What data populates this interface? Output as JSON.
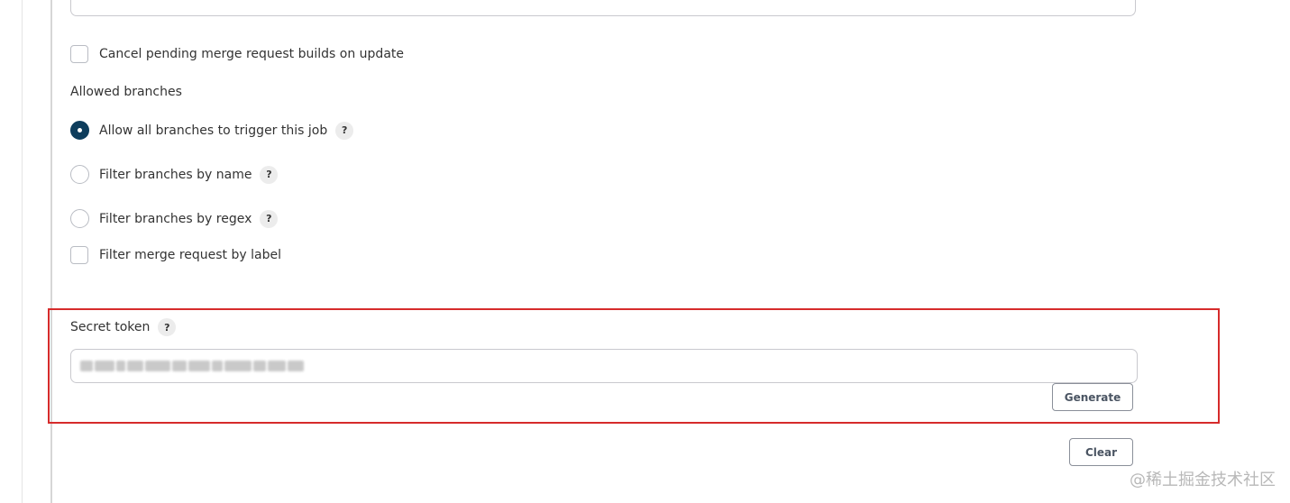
{
  "options": {
    "cancel_pending": {
      "label": "Cancel pending merge request builds on update",
      "checked": false
    }
  },
  "allowed_branches": {
    "label": "Allowed branches",
    "items": [
      {
        "label": "Allow all branches to trigger this job",
        "selected": true,
        "has_help": true,
        "help_glyph": "?"
      },
      {
        "label": "Filter branches by name",
        "selected": false,
        "has_help": true,
        "help_glyph": "?"
      },
      {
        "label": "Filter branches by regex",
        "selected": false,
        "has_help": true,
        "help_glyph": "?"
      }
    ],
    "filter_label": {
      "label": "Filter merge request by label",
      "checked": false
    }
  },
  "secret_token": {
    "label": "Secret token",
    "help_glyph": "?",
    "value_redacted": true,
    "generate_label": "Generate"
  },
  "clear_label": "Clear",
  "watermark": "@稀土掘金技术社区",
  "colors": {
    "radio_selected": "#0e3d5c",
    "highlight_border": "#d62b2b",
    "button_border": "#8a8f99"
  }
}
